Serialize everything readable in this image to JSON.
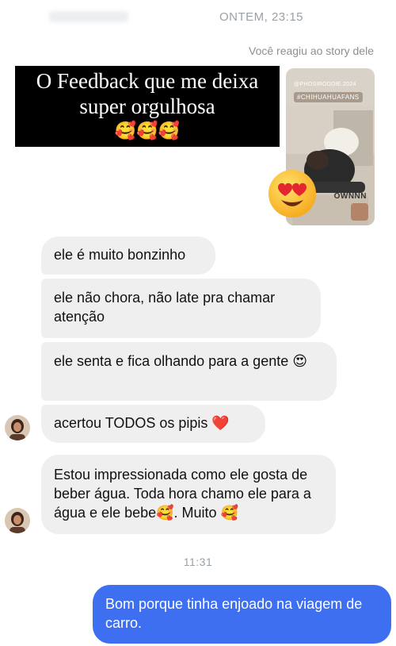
{
  "header": {
    "timestamp": "ONTEM, 23:15"
  },
  "reaction": {
    "note": "Você reagiu ao story dele"
  },
  "banner": {
    "line1": "O Feedback que me deixa",
    "line2": "super orgulhosa",
    "emojis": "🥰🥰🥰"
  },
  "story": {
    "hashtag_small": "@PHOSIRODDIE.2024",
    "hashtag": "#CHIHUAHUAFANS",
    "brand": "OWNNN"
  },
  "messages": [
    {
      "text": "ele é muito bonzinho"
    },
    {
      "text": "ele não chora, não late pra chamar atenção"
    },
    {
      "text": "ele senta e fica olhando para a gente 😍"
    },
    {
      "text": "acertou TODOS os pipis ❤️"
    },
    {
      "text": "Estou impressionada como ele gosta de beber água. Toda hora chamo ele para a água e ele bebe🥰. Muito 🥰"
    }
  ],
  "divider_time": "11:31",
  "sent_message": {
    "text": "Bom porque tinha enjoado na viagem de carro."
  },
  "colors": {
    "sent_bubble": "#3d6ff0",
    "received_bubble": "#efefef",
    "timestamp": "#9aa0a6"
  }
}
